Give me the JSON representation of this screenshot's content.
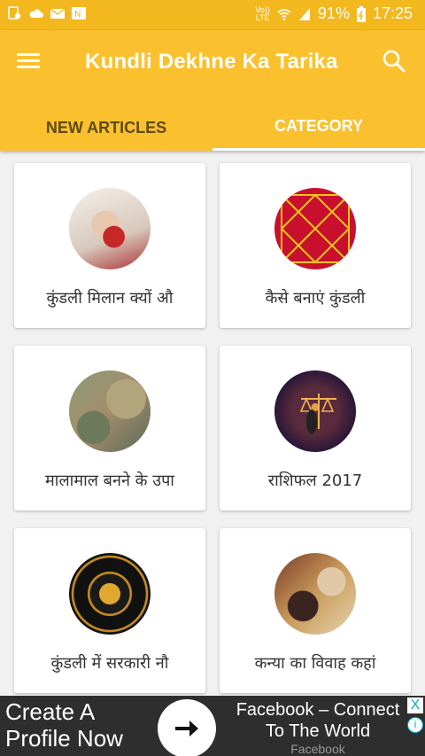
{
  "status_bar": {
    "volte_top": "Vo))",
    "volte_bottom": "LTE",
    "battery": "91%",
    "time": "17:25",
    "icons": [
      "sim-icon",
      "cloud-icon",
      "mail-icon",
      "office-icon",
      "wifi-icon",
      "signal-icon",
      "battery-icon"
    ]
  },
  "app_bar": {
    "title": "Kundli Dekhne Ka Tarika",
    "menu_icon": "hamburger-menu-icon",
    "search_icon": "search-icon",
    "background": "#fbc02d"
  },
  "tabs": [
    {
      "label": "NEW ARTICLES",
      "selected": false
    },
    {
      "label": "CATEGORY",
      "selected": true
    }
  ],
  "categories": [
    {
      "label": "कुंडली मिलान क्यों औ",
      "image": "wedding-hands"
    },
    {
      "label": "कैसे बनाएं कुंडली",
      "image": "kundli-chart"
    },
    {
      "label": "मालामाल बनने के उपा",
      "image": "money-notes"
    },
    {
      "label": "राशिफल 2017",
      "image": "zodiac-libra"
    },
    {
      "label": "कुंडली में सरकारी नौ",
      "image": "zodiac-wheel"
    },
    {
      "label": "कन्या का विवाह कहां",
      "image": "marriage-ritual"
    }
  ],
  "ad": {
    "left_line1": "Create A",
    "left_line2": "Profile Now",
    "right_line1": "Facebook – Connect",
    "right_line2": "To The World",
    "right_sub": "Facebook",
    "close": "X",
    "info": "i"
  }
}
